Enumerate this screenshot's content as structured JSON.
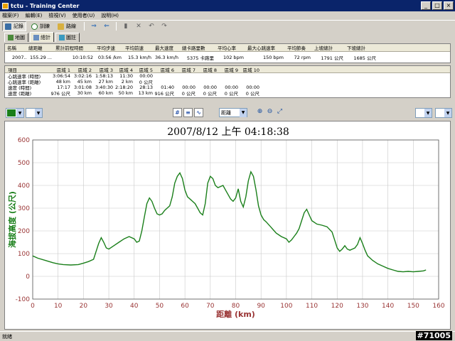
{
  "window": {
    "title": "tctu - Training Center"
  },
  "menu": [
    "檔案(F)",
    "編輯(E)",
    "檢視(V)",
    "使用者(U)",
    "說明(H)"
  ],
  "toolbar": {
    "history_label": "記錄",
    "training_label": "訓練",
    "courses_label": "路線"
  },
  "tabs": [
    {
      "label": "地圖"
    },
    {
      "label": "總計"
    },
    {
      "label": "圖註"
    }
  ],
  "summary": {
    "headers": [
      "名稱",
      "總距離",
      "累計前程時間",
      "平均步速",
      "平均前速",
      "最大速度",
      "總卡路里數",
      "平均心率",
      "最大心跳速率",
      "平均節奏",
      "上坡總計",
      "下坡總計"
    ],
    "row": [
      "2007...",
      "155.29 ...",
      "10:10:52",
      "03:56 /km",
      "15.3 km/h",
      "36.3 km/h",
      "5375 卡路里",
      "102 bpm",
      "150 bpm",
      "72 rpm",
      "1791 公尺",
      "1685 公尺"
    ]
  },
  "zones": {
    "headers": [
      "項目",
      "區域 1",
      "區域 2",
      "區域 3",
      "區域 4",
      "區域 5",
      "區域 6",
      "區域 7",
      "區域 8",
      "區域 9",
      "區域 10"
    ],
    "rows": [
      [
        "心跳速率 (時間)",
        "3:06:54",
        "3:02:16",
        "1:58:13",
        "11:30",
        "00:00",
        "",
        "",
        "",
        "",
        ""
      ],
      [
        "心跳速率 (距離)",
        "48 km",
        "45 km",
        "27 km",
        "2 km",
        "0 公尺",
        "",
        "",
        "",
        "",
        ""
      ],
      [
        "速度 (時間)",
        "17:17",
        "3:01:08",
        "3:40:30",
        "2:18:20",
        "28:13",
        "01:40",
        "00:00",
        "00:00",
        "00:00",
        "00:00"
      ],
      [
        "速度 (距離)",
        "976 公尺",
        "30 km",
        "60 km",
        "50 km",
        "13 km",
        "916 公尺",
        "0 公尺",
        "0 公尺",
        "0 公尺",
        "0 公尺"
      ]
    ]
  },
  "controls": {
    "xaxis_mode": "距離"
  },
  "status": {
    "text": "就緒"
  },
  "watermark": "#71005",
  "colors": {
    "line": "#1a7f1a",
    "axis": "#993333",
    "grid": "#c8c8c8",
    "title_bar": "#0a246a"
  },
  "chart_data": {
    "type": "line",
    "title": "2007/8/12 上午 04:18:38",
    "xlabel": "距離 (km)",
    "ylabel": "海拔高度 (公尺)",
    "xlim": [
      0,
      160
    ],
    "ylim": [
      -100,
      600
    ],
    "xticks": [
      0,
      10,
      20,
      30,
      40,
      50,
      60,
      70,
      80,
      90,
      100,
      110,
      120,
      130,
      140,
      150,
      160
    ],
    "yticks": [
      -100,
      0,
      100,
      200,
      300,
      400,
      500,
      600
    ],
    "grid": true,
    "series": [
      {
        "x": [
          0,
          2,
          5,
          8,
          10,
          12,
          15,
          18,
          20,
          22,
          24,
          25,
          26,
          27,
          28,
          29,
          30,
          32,
          34,
          36,
          38,
          40,
          41,
          42,
          43,
          44,
          45,
          46,
          47,
          48,
          49,
          50,
          51,
          52,
          53,
          54,
          55,
          56,
          57,
          58,
          59,
          60,
          61,
          62,
          63,
          64,
          65,
          66,
          67,
          68,
          69,
          70,
          71,
          72,
          73,
          74,
          75,
          76,
          77,
          78,
          79,
          80,
          81,
          82,
          83,
          84,
          85,
          86,
          87,
          88,
          89,
          90,
          91,
          92,
          94,
          96,
          98,
          100,
          101,
          102,
          103,
          104,
          105,
          106,
          107,
          108,
          109,
          110,
          112,
          114,
          116,
          118,
          119,
          120,
          121,
          122,
          123,
          124,
          125,
          126,
          127,
          128,
          129,
          130,
          131,
          132,
          134,
          136,
          138,
          140,
          142,
          144,
          146,
          148,
          150,
          152,
          154,
          155
        ],
        "y": [
          90,
          80,
          70,
          60,
          55,
          52,
          50,
          52,
          58,
          65,
          75,
          110,
          145,
          170,
          150,
          125,
          120,
          135,
          150,
          165,
          175,
          165,
          150,
          155,
          200,
          260,
          320,
          345,
          330,
          300,
          275,
          270,
          275,
          290,
          300,
          310,
          350,
          410,
          440,
          455,
          430,
          380,
          350,
          340,
          330,
          320,
          300,
          280,
          270,
          320,
          410,
          440,
          430,
          400,
          390,
          395,
          400,
          380,
          360,
          340,
          330,
          345,
          385,
          330,
          305,
          350,
          420,
          460,
          440,
          380,
          310,
          270,
          250,
          240,
          215,
          190,
          175,
          165,
          150,
          160,
          175,
          190,
          210,
          245,
          280,
          295,
          270,
          245,
          230,
          225,
          218,
          195,
          160,
          125,
          110,
          120,
          135,
          120,
          115,
          120,
          125,
          140,
          170,
          145,
          115,
          90,
          70,
          55,
          45,
          35,
          28,
          22,
          20,
          22,
          20,
          22,
          24,
          28
        ]
      }
    ]
  }
}
